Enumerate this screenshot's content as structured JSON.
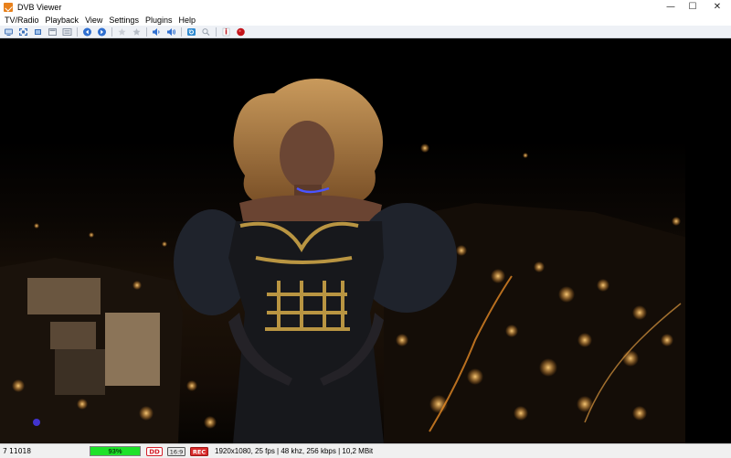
{
  "window": {
    "title": "DVB Viewer",
    "minimize": "—",
    "maximize": "☐",
    "close": "✕"
  },
  "menu": [
    "TV/Radio",
    "Playback",
    "View",
    "Settings",
    "Plugins",
    "Help"
  ],
  "toolbar": {
    "buttons": [
      {
        "icon": "screen-icon",
        "color": "#4a78b8"
      },
      {
        "icon": "fullscreen-icon",
        "color": "#3a6fb8"
      },
      {
        "icon": "window-icon",
        "color": "#3a6fb8"
      },
      {
        "icon": "desktop-icon",
        "color": "#8a95a5"
      },
      {
        "icon": "channel-list-icon",
        "color": "#8a95a5"
      },
      {
        "icon": "previous-channel-icon",
        "color": "#2f6fd0"
      },
      {
        "icon": "next-channel-icon",
        "color": "#2f6fd0"
      },
      {
        "icon": "favorite-icon",
        "color": "#9aa3af"
      },
      {
        "icon": "favorite-add-icon",
        "color": "#9aa3af"
      },
      {
        "icon": "volume-down-icon",
        "color": "#2f6fd0"
      },
      {
        "icon": "volume-up-icon",
        "color": "#2f6fd0"
      },
      {
        "icon": "refresh-icon",
        "color": "#2f8ad0"
      },
      {
        "icon": "zoom-icon",
        "color": "#9aa3af"
      },
      {
        "icon": "info-icon",
        "color": "#c0262d"
      },
      {
        "icon": "record-icon",
        "color": "#c4141a"
      }
    ]
  },
  "status": {
    "channel": "7 11018",
    "signal_label": "93%",
    "signal_level": 1.0,
    "signal_color": "#1fe22a",
    "badge_dolby": "DD",
    "badge_aspect": "16:9",
    "badge_rec": "REC",
    "info": "1920x1080, 25 fps | 48 khz, 256 kbps | 10,2 MBit"
  }
}
